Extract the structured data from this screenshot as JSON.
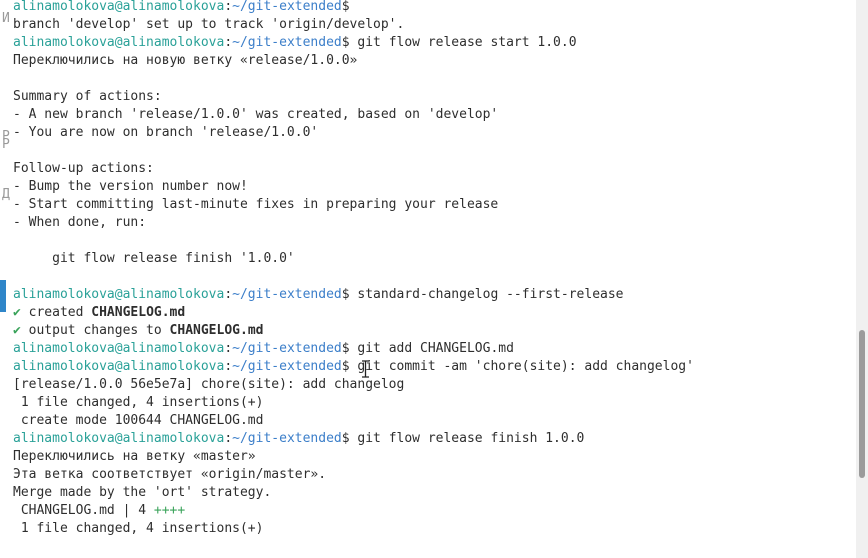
{
  "colors": {
    "prompt_user": "#2aa198",
    "prompt_path": "#3b7ec9",
    "text": "#2e2e2e",
    "check": "#3aa35a",
    "background": "#ffffff"
  },
  "background_glyphs": [
    "И",
    "Р",
    "Р",
    "Д"
  ],
  "terminal": {
    "lines": [
      [
        {
          "t": "alinamolokova@alinamolokova",
          "c": "user"
        },
        {
          "t": ":",
          "c": "plain"
        },
        {
          "t": "~/git-extended",
          "c": "path"
        },
        {
          "t": "$",
          "c": "plain"
        }
      ],
      [
        {
          "t": "branch 'develop' set up to track 'origin/develop'.",
          "c": "plain"
        }
      ],
      [
        {
          "t": "alinamolokova@alinamolokova",
          "c": "user"
        },
        {
          "t": ":",
          "c": "plain"
        },
        {
          "t": "~/git-extended",
          "c": "path"
        },
        {
          "t": "$ git flow release start 1.0.0",
          "c": "plain"
        }
      ],
      [
        {
          "t": "Переключились на новую ветку «release/1.0.0»",
          "c": "plain"
        }
      ],
      [],
      [
        {
          "t": "Summary of actions:",
          "c": "plain"
        }
      ],
      [
        {
          "t": "- A new branch 'release/1.0.0' was created, based on 'develop'",
          "c": "plain"
        }
      ],
      [
        {
          "t": "- You are now on branch 'release/1.0.0'",
          "c": "plain"
        }
      ],
      [],
      [
        {
          "t": "Follow-up actions:",
          "c": "plain"
        }
      ],
      [
        {
          "t": "- Bump the version number now!",
          "c": "plain"
        }
      ],
      [
        {
          "t": "- Start committing last-minute fixes in preparing your release",
          "c": "plain"
        }
      ],
      [
        {
          "t": "- When done, run:",
          "c": "plain"
        }
      ],
      [],
      [
        {
          "t": "     git flow release finish '1.0.0'",
          "c": "plain"
        }
      ],
      [],
      [
        {
          "t": "alinamolokova@alinamolokova",
          "c": "user"
        },
        {
          "t": ":",
          "c": "plain"
        },
        {
          "t": "~/git-extended",
          "c": "path"
        },
        {
          "t": "$ standard-changelog --first-release",
          "c": "plain"
        }
      ],
      [
        {
          "t": "✔",
          "c": "check"
        },
        {
          "t": " created ",
          "c": "plain"
        },
        {
          "t": "CHANGELOG.md",
          "c": "bold"
        }
      ],
      [
        {
          "t": "✔",
          "c": "check"
        },
        {
          "t": " output changes to ",
          "c": "plain"
        },
        {
          "t": "CHANGELOG.md",
          "c": "bold"
        }
      ],
      [
        {
          "t": "alinamolokova@alinamolokova",
          "c": "user"
        },
        {
          "t": ":",
          "c": "plain"
        },
        {
          "t": "~/git-extended",
          "c": "path"
        },
        {
          "t": "$ git add CHANGELOG.md",
          "c": "plain"
        }
      ],
      [
        {
          "t": "alinamolokova@alinamolokova",
          "c": "user"
        },
        {
          "t": ":",
          "c": "plain"
        },
        {
          "t": "~/git-extended",
          "c": "path"
        },
        {
          "t": "$ git commit -am 'chore(site): add changelog'",
          "c": "plain"
        }
      ],
      [
        {
          "t": "[release/1.0.0 56e5e7a] chore(site): add changelog",
          "c": "plain"
        }
      ],
      [
        {
          "t": " 1 file changed, 4 insertions(+)",
          "c": "plain"
        }
      ],
      [
        {
          "t": " create mode 100644 CHANGELOG.md",
          "c": "plain"
        }
      ],
      [
        {
          "t": "alinamolokova@alinamolokova",
          "c": "user"
        },
        {
          "t": ":",
          "c": "plain"
        },
        {
          "t": "~/git-extended",
          "c": "path"
        },
        {
          "t": "$ git flow release finish 1.0.0",
          "c": "plain"
        }
      ],
      [
        {
          "t": "Переключились на ветку «master»",
          "c": "plain"
        }
      ],
      [
        {
          "t": "Эта ветка соответствует «origin/master».",
          "c": "plain"
        }
      ],
      [
        {
          "t": "Merge made by the 'ort' strategy.",
          "c": "plain"
        }
      ],
      [
        {
          "t": " CHANGELOG.md | 4 ",
          "c": "plain"
        },
        {
          "t": "++++",
          "c": "plus"
        }
      ],
      [
        {
          "t": " 1 file changed, 4 insertions(+)",
          "c": "plain"
        }
      ]
    ]
  }
}
